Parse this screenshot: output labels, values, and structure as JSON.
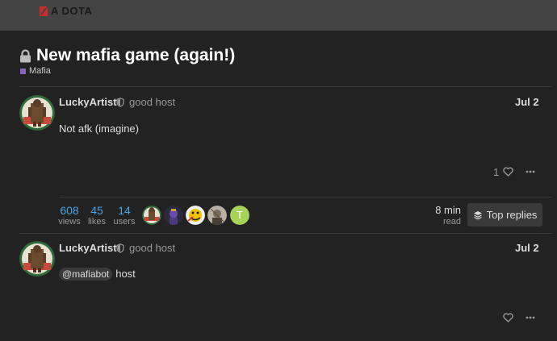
{
  "header": {
    "logo_text": "A DOTA"
  },
  "topic": {
    "title": "New mafia game (again!)",
    "category": "Mafia",
    "category_color": "#8b5fbf"
  },
  "posts": [
    {
      "username": "LuckyArtist",
      "user_title": "good host",
      "date": "Jul 2",
      "text": "Not afk (imagine)",
      "likes": "1"
    },
    {
      "username": "LuckyArtist",
      "user_title": "good host",
      "date": "Jul 2",
      "mention": "@mafiabot",
      "text": "host"
    }
  ],
  "topic_map": {
    "views_count": "608",
    "views_label": "views",
    "likes_count": "45",
    "likes_label": "likes",
    "users_count": "14",
    "users_label": "users",
    "participant_last_initial": "T",
    "read_time": "8 min",
    "read_label": "read",
    "top_replies_label": "Top replies"
  },
  "colors": {
    "accent": "#4ba3e3",
    "background": "#222222",
    "header": "#444444"
  }
}
